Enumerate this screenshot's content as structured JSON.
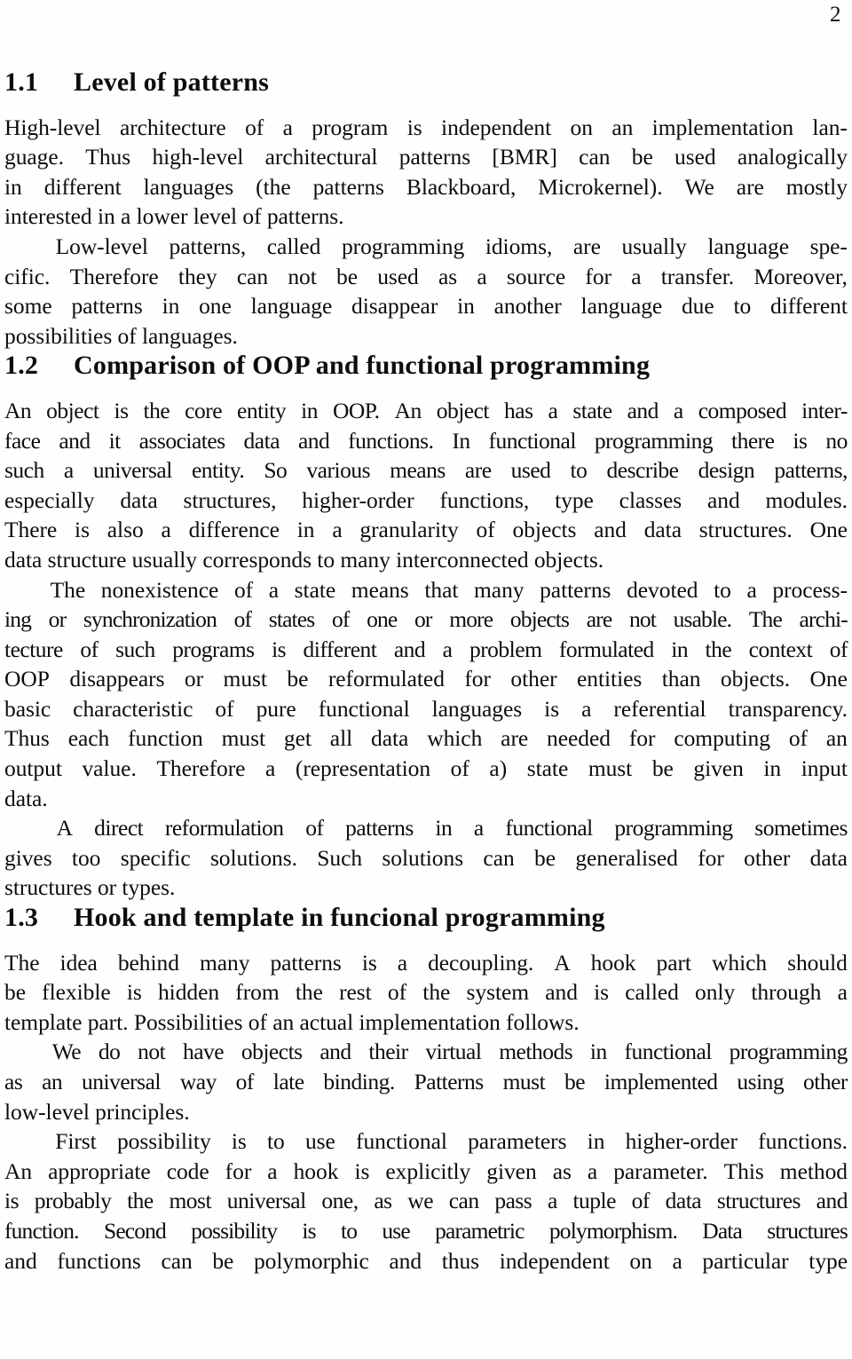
{
  "page": {
    "folio": "2",
    "background_color": "#fefefe",
    "text_color": "#0d0d0d"
  },
  "sections": [
    {
      "id": "1.1",
      "number": "1.1",
      "title": "Level of patterns",
      "paragraphs": [
        {
          "indent": false,
          "lines": [
            "High-level architecture of a program is independent on an implementation lan-",
            "guage. Thus high-level architectural patterns [BMR] can be used analogically",
            "in different languages (the patterns Blackboard, Microkernel). We are mostly",
            "interested in a lower level of patterns."
          ]
        },
        {
          "indent": true,
          "lines": [
            "Low-level patterns, called programming idioms, are usually language spe-",
            "cific. Therefore they can not be used as a source for a transfer. Moreover,",
            "some patterns in one language disappear in another language due to different",
            "possibilities of languages."
          ]
        }
      ]
    },
    {
      "id": "1.2",
      "number": "1.2",
      "title": "Comparison of OOP and functional programming",
      "paragraphs": [
        {
          "indent": false,
          "lines": [
            "An object is the core entity in OOP. An object has a state and a composed inter-",
            "face and it associates data and functions. In functional programming there is no",
            "such a universal entity. So various means are used to describe design patterns,",
            "especially data structures, higher-order functions, type classes and modules.",
            "There is also a difference in a granularity of objects and data structures. One",
            "data structure usually corresponds to many interconnected objects."
          ]
        },
        {
          "indent": true,
          "lines": [
            "The nonexistence of a state means that many patterns devoted to a process-",
            "ing or synchronization of states of one or more objects are not usable. The archi-",
            "tecture of such programs is different and a problem formulated in the context of",
            "OOP disappears or must be reformulated for other entities than objects. One",
            "basic characteristic of pure functional languages is a referential transparency.",
            "Thus each function must get all data which are needed for computing of an",
            "output value. Therefore a (representation of a) state must be given in input",
            "data."
          ]
        },
        {
          "indent": true,
          "lines": [
            "A direct reformulation of patterns in a functional programming sometimes",
            "gives too specific solutions. Such solutions can be generalised for other data",
            "structures or types."
          ]
        }
      ]
    },
    {
      "id": "1.3",
      "number": "1.3",
      "title": "Hook and template in funcional programming",
      "paragraphs": [
        {
          "indent": false,
          "lines": [
            "The idea behind many patterns is a decoupling. A hook part which should",
            "be flexible is hidden from the rest of the system and is called only through a",
            "template part. Possibilities of an actual implementation follows."
          ]
        },
        {
          "indent": true,
          "lines": [
            "We do not have objects and their virtual methods in functional programming",
            "as an universal way of late binding. Patterns must be implemented using other",
            "low-level principles."
          ]
        },
        {
          "indent": true,
          "lines": [
            "First possibility is to use functional parameters in higher-order functions.",
            "An appropriate code for a hook is explicitly given as a parameter. This method",
            "is probably the most universal one, as we can pass a tuple of data structures and",
            "function. Second possibility is to use parametric polymorphism. Data structures",
            "and functions can be polymorphic and thus independent on a particular type"
          ]
        }
      ]
    }
  ]
}
